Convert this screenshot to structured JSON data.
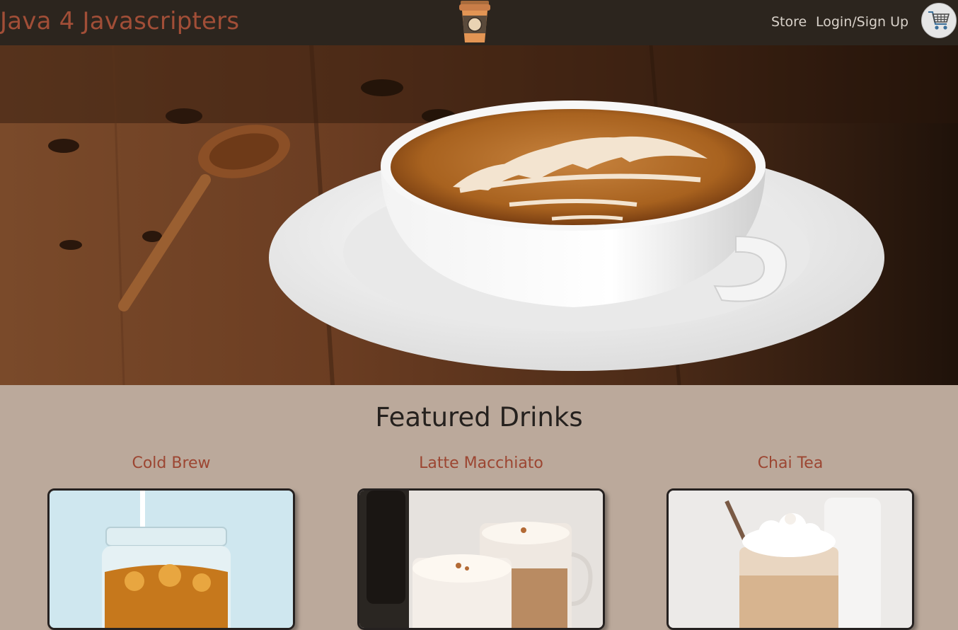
{
  "navbar": {
    "brand": "Java 4 Javascripters",
    "logo_icon": "coffee-cup-icon",
    "links": {
      "store": "Store",
      "login": "Login/Sign Up"
    },
    "cart_icon": "shopping-cart-icon"
  },
  "hero": {
    "image": "latte-art-cup-on-saucer-with-wooden-spoon"
  },
  "featured": {
    "title": "Featured Drinks",
    "drinks": [
      {
        "name": "Cold Brew",
        "image": "iced-cold-brew-jar"
      },
      {
        "name": "Latte Macchiato",
        "image": "latte-macchiato-glasses"
      },
      {
        "name": "Chai Tea",
        "image": "iced-chai-with-whipped-cream"
      }
    ]
  },
  "colors": {
    "navbar_bg": "#2c251e",
    "brand": "#a14e37",
    "nav_link": "#d9d2ca",
    "page_bg": "#bba99b",
    "drink_name": "#9c4632",
    "heading": "#25211e"
  }
}
